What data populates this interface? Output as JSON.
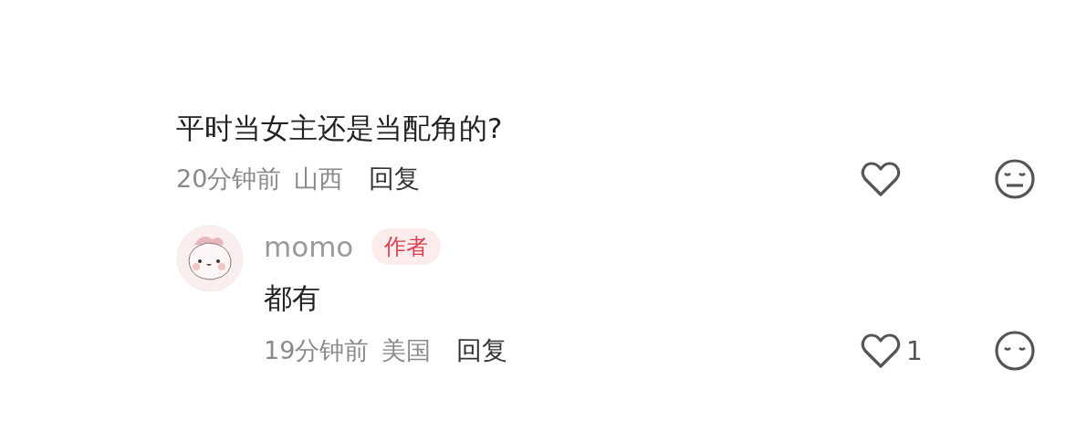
{
  "comment": {
    "text": "平时当女主还是当配角的?",
    "time": "20分钟前",
    "location": "山西",
    "reply_label": "回复",
    "reply": {
      "author": "momo",
      "badge": "作者",
      "text": "都有",
      "time": "19分钟前",
      "location": "美国",
      "reply_label": "回复",
      "like_count": "1"
    }
  }
}
